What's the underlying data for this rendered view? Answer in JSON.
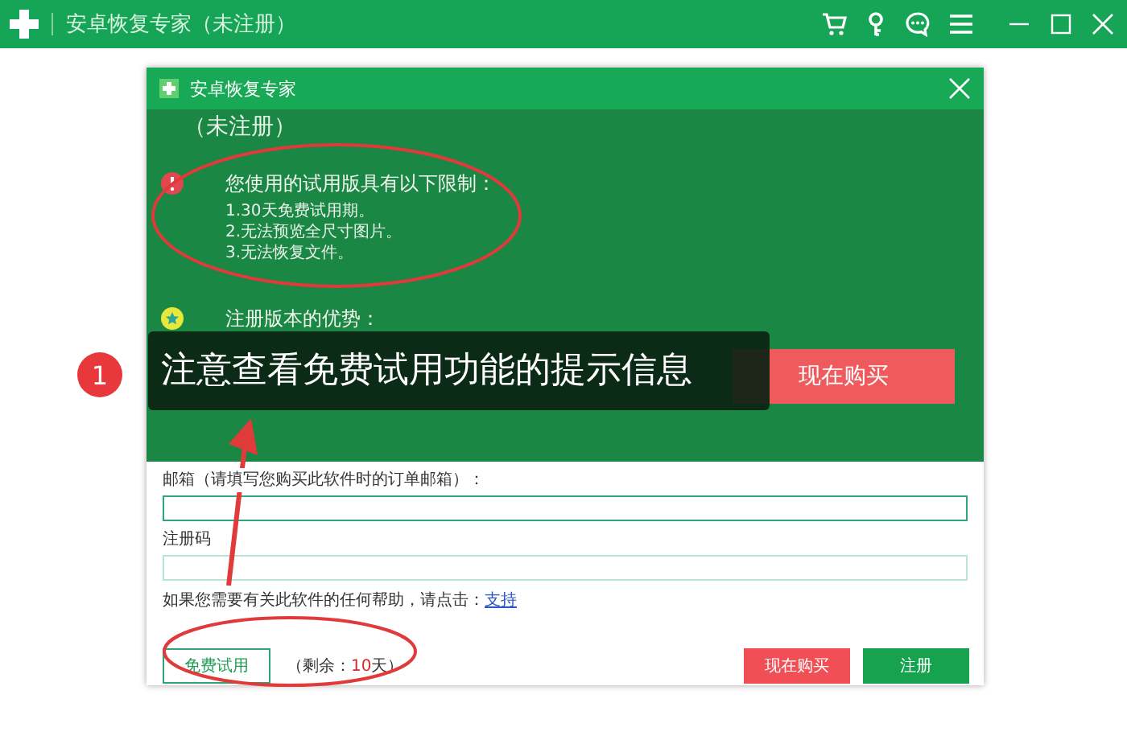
{
  "app_bar": {
    "title": "安卓恢复专家（未注册）"
  },
  "dialog": {
    "title": "安卓恢复专家",
    "status": "（未注册）",
    "limits": {
      "heading": "您使用的试用版具有以下限制：",
      "items": [
        "1.30天免费试用期。",
        "2.无法预览全尺寸图片。",
        "3.无法恢复文件。"
      ]
    },
    "advantages": {
      "heading": "注册版本的优势："
    },
    "buy_button": "现在购买",
    "email": {
      "label": "邮箱（请填写您购买此软件时的订单邮箱）：",
      "focused": true
    },
    "code": {
      "label": "注册码",
      "focused": false
    },
    "help": {
      "text": "如果您需要有关此软件的任何帮助，请点击：",
      "link": "支持"
    },
    "trial_button": "免费试用",
    "remaining": {
      "prefix": "（剩余：",
      "days": "10",
      "suffix": "天）"
    },
    "footer_buttons": [
      {
        "label": "现在购买",
        "kind": "buy"
      },
      {
        "label": "注册",
        "kind": "register"
      }
    ]
  },
  "annotation": {
    "badge": "1",
    "text": "注意查看免费试用功能的提示信息"
  }
}
